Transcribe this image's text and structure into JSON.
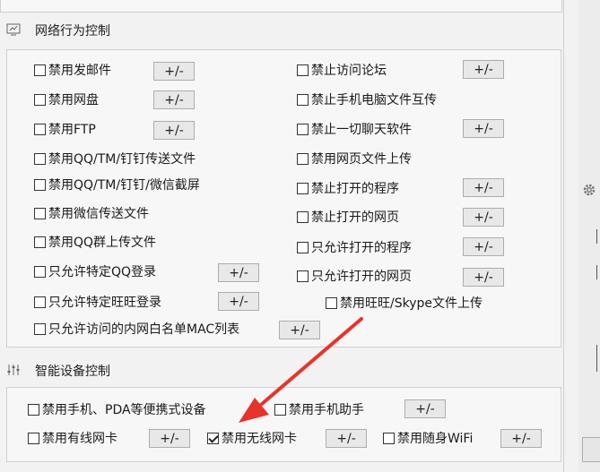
{
  "network": {
    "title": "网络行为控制",
    "pm_label": "+/-",
    "items": [
      {
        "label": "禁用发邮件",
        "checked": false,
        "has_pm": true
      },
      {
        "label": "禁用网盘",
        "checked": false,
        "has_pm": true
      },
      {
        "label": "禁用FTP",
        "checked": false,
        "has_pm": true
      },
      {
        "label": "禁用QQ/TM/钉钉传送文件",
        "checked": false,
        "has_pm": false
      },
      {
        "label": "禁用QQ/TM/钉钉/微信截屏",
        "checked": false,
        "has_pm": false
      },
      {
        "label": "禁用微信传送文件",
        "checked": false,
        "has_pm": false
      },
      {
        "label": "禁用QQ群上传文件",
        "checked": false,
        "has_pm": false
      },
      {
        "label": "只允许特定QQ登录",
        "checked": false,
        "has_pm": true
      },
      {
        "label": "只允许特定旺旺登录",
        "checked": false,
        "has_pm": true
      },
      {
        "label": "只允许访问的内网白名单MAC列表",
        "checked": false,
        "has_pm": true
      },
      {
        "label": "禁止访问论坛",
        "checked": false,
        "has_pm": true
      },
      {
        "label": "禁止手机电脑文件互传",
        "checked": false,
        "has_pm": false
      },
      {
        "label": "禁止一切聊天软件",
        "checked": false,
        "has_pm": true
      },
      {
        "label": "禁用网页文件上传",
        "checked": false,
        "has_pm": false
      },
      {
        "label": "禁止打开的程序",
        "checked": false,
        "has_pm": true
      },
      {
        "label": "禁止打开的网页",
        "checked": false,
        "has_pm": true
      },
      {
        "label": "只允许打开的程序",
        "checked": false,
        "has_pm": true
      },
      {
        "label": "只允许打开的网页",
        "checked": false,
        "has_pm": true
      },
      {
        "label": "禁用旺旺/Skype文件上传",
        "checked": false,
        "has_pm": false
      }
    ]
  },
  "smart": {
    "title": "智能设备控制",
    "pm_label": "+/-",
    "items": [
      {
        "label": "禁用手机、PDA等便携式设备",
        "checked": false,
        "has_pm": false
      },
      {
        "label": "禁用手机助手",
        "checked": false,
        "has_pm": true
      },
      {
        "label": "禁用有线网卡",
        "checked": false,
        "has_pm": true
      },
      {
        "label": "禁用无线网卡",
        "checked": true,
        "has_pm": true
      },
      {
        "label": "禁用随身WiFi",
        "checked": false,
        "has_pm": true
      }
    ]
  },
  "colors": {
    "arrow": "#e8332a",
    "border": "#cfcfcf",
    "button_bg": "#e8e8e8"
  },
  "icons": [
    "network-monitor-icon",
    "sliders-icon",
    "gear-icon",
    "red-annotation-arrow"
  ]
}
